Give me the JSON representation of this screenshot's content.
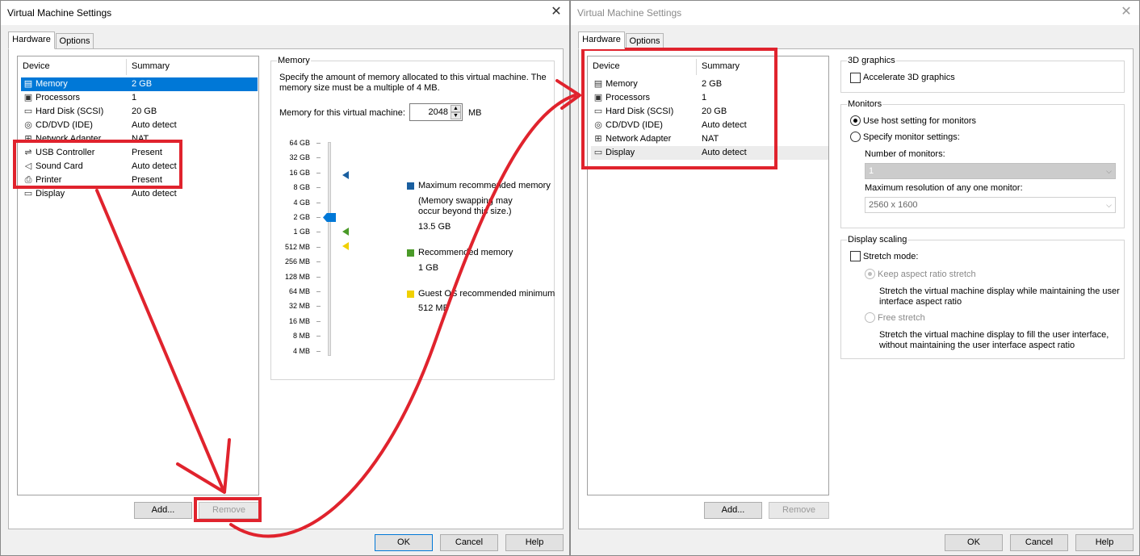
{
  "colors": {
    "accent": "#0078d7",
    "annotation_red": "#e0232d",
    "max_marker": "#1a5fa0",
    "rec_marker": "#4a9a28",
    "min_marker": "#f0d000"
  },
  "left": {
    "title": "Virtual Machine Settings",
    "tabs": [
      {
        "label": "Hardware",
        "active": true
      },
      {
        "label": "Options",
        "active": false
      }
    ],
    "col_device": "Device",
    "col_summary": "Summary",
    "devices": [
      {
        "icon": "memory-icon",
        "name": "Memory",
        "summary": "2 GB",
        "selected": true
      },
      {
        "icon": "processor-icon",
        "name": "Processors",
        "summary": "1"
      },
      {
        "icon": "hard-disk-icon",
        "name": "Hard Disk (SCSI)",
        "summary": "20 GB"
      },
      {
        "icon": "cd-dvd-icon",
        "name": "CD/DVD (IDE)",
        "summary": "Auto detect"
      },
      {
        "icon": "network-adapter-icon",
        "name": "Network Adapter",
        "summary": "NAT"
      },
      {
        "icon": "usb-icon",
        "name": "USB Controller",
        "summary": "Present"
      },
      {
        "icon": "sound-icon",
        "name": "Sound Card",
        "summary": "Auto detect"
      },
      {
        "icon": "printer-icon",
        "name": "Printer",
        "summary": "Present"
      },
      {
        "icon": "display-icon",
        "name": "Display",
        "summary": "Auto detect"
      }
    ],
    "add_label": "Add...",
    "remove_label": "Remove",
    "ok_label": "OK",
    "cancel_label": "Cancel",
    "help_label": "Help",
    "memory": {
      "group_title": "Memory",
      "description_1": "Specify the amount of memory allocated to this virtual machine. The",
      "description_2": "memory size must be a multiple of 4 MB.",
      "field_label": "Memory for this virtual machine:",
      "value": "2048",
      "unit": "MB",
      "scale": [
        "64 GB",
        "32 GB",
        "16 GB",
        "8 GB",
        "4 GB",
        "2 GB",
        "1 GB",
        "512 MB",
        "256 MB",
        "128 MB",
        "64 MB",
        "32 MB",
        "16 MB",
        "8 MB",
        "4 MB"
      ],
      "legend": [
        {
          "title": "Maximum recommended memory",
          "note_1": "(Memory swapping may",
          "note_2": "occur beyond this size.)",
          "value": "13.5 GB"
        },
        {
          "title": "Recommended memory",
          "value": "1 GB"
        },
        {
          "title": "Guest OS recommended minimum",
          "value": "512 MB"
        }
      ]
    }
  },
  "right": {
    "title": "Virtual Machine Settings",
    "tabs": [
      {
        "label": "Hardware",
        "active": true
      },
      {
        "label": "Options",
        "active": false
      }
    ],
    "col_device": "Device",
    "col_summary": "Summary",
    "devices": [
      {
        "icon": "memory-icon",
        "name": "Memory",
        "summary": "2 GB"
      },
      {
        "icon": "processor-icon",
        "name": "Processors",
        "summary": "1"
      },
      {
        "icon": "hard-disk-icon",
        "name": "Hard Disk (SCSI)",
        "summary": "20 GB"
      },
      {
        "icon": "cd-dvd-icon",
        "name": "CD/DVD (IDE)",
        "summary": "Auto detect"
      },
      {
        "icon": "network-adapter-icon",
        "name": "Network Adapter",
        "summary": "NAT"
      },
      {
        "icon": "display-icon",
        "name": "Display",
        "summary": "Auto detect",
        "hover": true
      }
    ],
    "add_label": "Add...",
    "remove_label": "Remove",
    "ok_label": "OK",
    "cancel_label": "Cancel",
    "help_label": "Help",
    "display": {
      "g3d_title": "3D graphics",
      "accelerate_label": "Accelerate 3D graphics",
      "monitors_title": "Monitors",
      "use_host_label": "Use host setting for monitors",
      "specify_label": "Specify monitor settings:",
      "num_monitors_label": "Number of monitors:",
      "num_monitors_value": "1",
      "max_res_label": "Maximum resolution of any one monitor:",
      "max_res_value": "2560 x 1600",
      "scaling_title": "Display scaling",
      "stretch_label": "Stretch mode:",
      "keep_label": "Keep aspect ratio stretch",
      "keep_desc_1": "Stretch the virtual machine display while maintaining the user",
      "keep_desc_2": "interface aspect ratio",
      "free_label": "Free stretch",
      "free_desc_1": "Stretch the virtual machine display to fill the user interface,",
      "free_desc_2": "without maintaining the user interface aspect ratio"
    }
  }
}
